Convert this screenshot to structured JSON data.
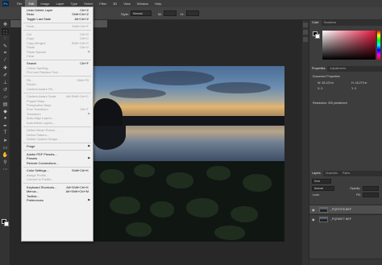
{
  "app": {
    "logo": "Ps"
  },
  "menubar": {
    "items": [
      "File",
      "Edit",
      "Image",
      "Layer",
      "Type",
      "Select",
      "Filter",
      "3D",
      "View",
      "Window",
      "Help"
    ]
  },
  "options_bar": {
    "style_label": "Style:",
    "style_value": "Normal",
    "width_label": "W:",
    "height_label": "H:"
  },
  "edit_menu": [
    {
      "label": "Undo Delete Layer",
      "shortcut": "Ctrl+Z"
    },
    {
      "label": "Redo",
      "shortcut": "Shift+Ctrl+Z"
    },
    {
      "label": "Toggle Last State",
      "shortcut": "Alt+Ctrl+Z"
    },
    {
      "sep": true
    },
    {
      "label": "Fade...",
      "shortcut": "Shift+Ctrl+F",
      "disabled": true
    },
    {
      "sep": true
    },
    {
      "label": "Cut",
      "shortcut": "Ctrl+X",
      "disabled": true
    },
    {
      "label": "Copy",
      "shortcut": "Ctrl+C",
      "disabled": true
    },
    {
      "label": "Copy Merged",
      "shortcut": "Shift+Ctrl+C",
      "disabled": true
    },
    {
      "label": "Paste",
      "shortcut": "Ctrl+V",
      "disabled": true
    },
    {
      "label": "Paste Special",
      "arrow": true,
      "disabled": true
    },
    {
      "label": "Clear",
      "disabled": true
    },
    {
      "sep": true
    },
    {
      "label": "Search",
      "shortcut": "Ctrl+F"
    },
    {
      "label": "Check Spelling...",
      "disabled": true
    },
    {
      "label": "Find and Replace Text...",
      "disabled": true
    },
    {
      "sep": true
    },
    {
      "label": "Fill...",
      "shortcut": "Shift+F5",
      "disabled": true
    },
    {
      "label": "Stroke...",
      "disabled": true
    },
    {
      "label": "Content-Aware Fill...",
      "disabled": true
    },
    {
      "sep": true
    },
    {
      "label": "Content-Aware Scale",
      "shortcut": "Alt+Shift+Ctrl+C",
      "disabled": true
    },
    {
      "label": "Puppet Warp",
      "disabled": true
    },
    {
      "label": "Perspective Warp",
      "disabled": true
    },
    {
      "label": "Free Transform",
      "shortcut": "Ctrl+T",
      "disabled": true
    },
    {
      "label": "Transform",
      "arrow": true,
      "disabled": true
    },
    {
      "label": "Auto-Align Layers...",
      "disabled": true
    },
    {
      "label": "Auto-Blend Layers...",
      "disabled": true
    },
    {
      "sep": true
    },
    {
      "label": "Define Brush Preset...",
      "disabled": true
    },
    {
      "label": "Define Pattern...",
      "disabled": true
    },
    {
      "label": "Define Custom Shape...",
      "disabled": true
    },
    {
      "sep": true
    },
    {
      "label": "Purge",
      "arrow": true
    },
    {
      "sep": true
    },
    {
      "label": "Adobe PDF Presets..."
    },
    {
      "label": "Presets",
      "arrow": true
    },
    {
      "label": "Remote Connections..."
    },
    {
      "sep": true
    },
    {
      "label": "Color Settings...",
      "shortcut": "Shift+Ctrl+K"
    },
    {
      "label": "Assign Profile...",
      "disabled": true
    },
    {
      "label": "Convert to Profile...",
      "disabled": true
    },
    {
      "sep": true
    },
    {
      "label": "Keyboard Shortcuts...",
      "shortcut": "Alt+Shift+Ctrl+K"
    },
    {
      "label": "Menus...",
      "shortcut": "Alt+Shift+Ctrl+M"
    },
    {
      "label": "Toolbar..."
    },
    {
      "label": "Preferences",
      "arrow": true
    }
  ],
  "panels": {
    "color_tabs": [
      "Color",
      "Swatches"
    ],
    "props_tabs": [
      "Properties",
      "Adjustments"
    ],
    "props_title": "Document Properties",
    "props_w": "W: 26.123 in",
    "props_h": "H: 18.273 in",
    "props_x": "X: 0",
    "props_y": "Y: 0",
    "resolution": "Resolution: 200 pixels/inch",
    "layers_tabs": [
      "Layers",
      "Channels",
      "Paths"
    ],
    "kind_label": "Kind",
    "blend_mode": "Normal",
    "opacity_label": "Opacity:",
    "lock_label": "Lock:",
    "fill_label": "Fill:",
    "layers": [
      {
        "name": "_PQR7076.NEF"
      },
      {
        "name": "_PQR8977.NEF"
      }
    ]
  },
  "colors": {
    "accent": "#31a8ff",
    "picker_hue": "#e8173d"
  }
}
